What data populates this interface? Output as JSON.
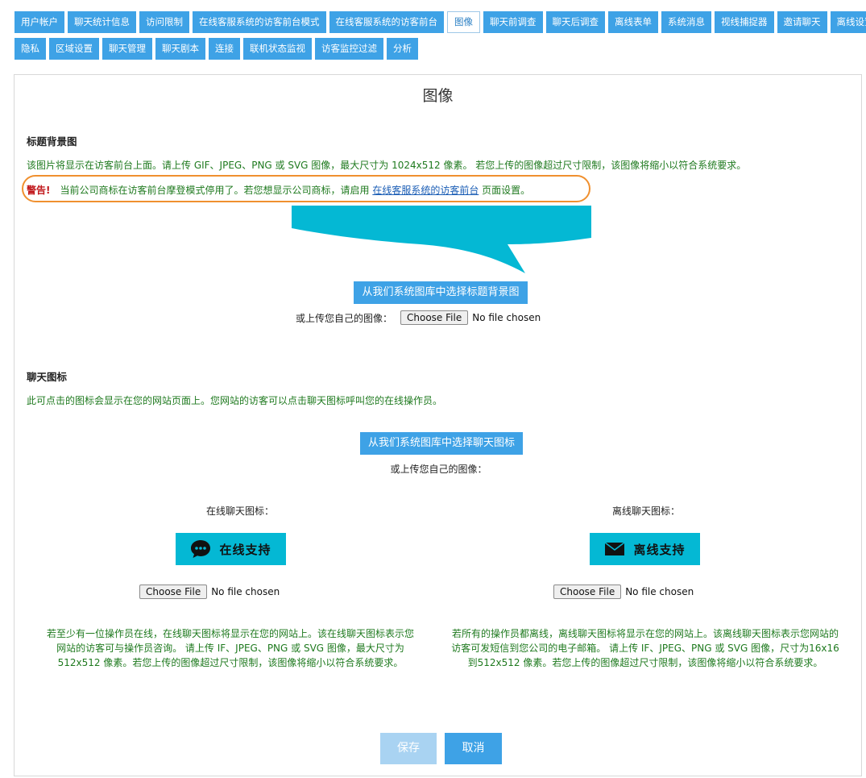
{
  "nav": {
    "row1": [
      "用户帐户",
      "聊天统计信息",
      "访问限制",
      "在线客服系统的访客前台模式",
      "在线客服系统的访客前台",
      "图像",
      "聊天前调查",
      "聊天后调查",
      "离线表单",
      "系统消息",
      "视线捕捉器",
      "邀请聊天",
      "离线设置"
    ],
    "row2": [
      "隐私",
      "区域设置",
      "聊天管理",
      "聊天剧本",
      "连接",
      "联机状态监视",
      "访客监控过滤",
      "分析"
    ],
    "active": "图像"
  },
  "page": {
    "title": "图像"
  },
  "header_bg": {
    "heading": "标题背景图",
    "description": "该图片将显示在访客前台上面。请上传 GIF、JPEG、PNG 或 SVG 图像，最大尺寸为 1024x512 像素。 若您上传的图像超过尺寸限制，该图像将缩小以符合系统要求。",
    "warning_label": "警告!",
    "warning_text": "当前公司商标在访客前台摩登模式停用了。若您想显示公司商标，请启用",
    "warning_link": "在线客服系统的访客前台",
    "warning_suffix": "页面设置。",
    "library_button": "从我们系统图库中选择标题背景图",
    "upload_label": "或上传您自己的图像：",
    "file_button": "Choose File",
    "file_status": "No file chosen",
    "accent_color": "#04b8d4"
  },
  "chat_icon": {
    "heading": "聊天图标",
    "description": "此可点击的图标会显示在您的网站页面上。您网站的访客可以点击聊天图标呼叫您的在线操作员。",
    "library_button": "从我们系统图库中选择聊天图标",
    "upload_label": "或上传您自己的图像：",
    "online": {
      "label": "在线聊天图标：",
      "icon_text": "在线支持",
      "icon_name": "speech-bubble-icon",
      "file_button": "Choose File",
      "file_status": "No file chosen",
      "note": "若至少有一位操作员在线，在线聊天图标将显示在您的网站上。该在线聊天图标表示您网站的访客可与操作员咨询。 请上传 IF、JPEG、PNG 或 SVG 图像，最大尺寸为512x512 像素。若您上传的图像超过尺寸限制，该图像将缩小以符合系统要求。"
    },
    "offline": {
      "label": "离线聊天图标：",
      "icon_text": "离线支持",
      "icon_name": "envelope-icon",
      "file_button": "Choose File",
      "file_status": "No file chosen",
      "note": "若所有的操作员都离线，离线聊天图标将显示在您的网站上。该离线聊天图标表示您网站的访客可发短信到您公司的电子邮箱。 请上传 IF、JPEG、PNG 或 SVG 图像，尺寸为16x16 到512x512 像素。若您上传的图像超过尺寸限制，该图像将缩小以符合系统要求。"
    }
  },
  "footer": {
    "save": "保存",
    "cancel": "取消"
  },
  "colors": {
    "tab": "#3ea2e6",
    "text_green": "#1f7a1f",
    "warning_red": "#c0161a",
    "highlight_orange": "#f0902f"
  }
}
